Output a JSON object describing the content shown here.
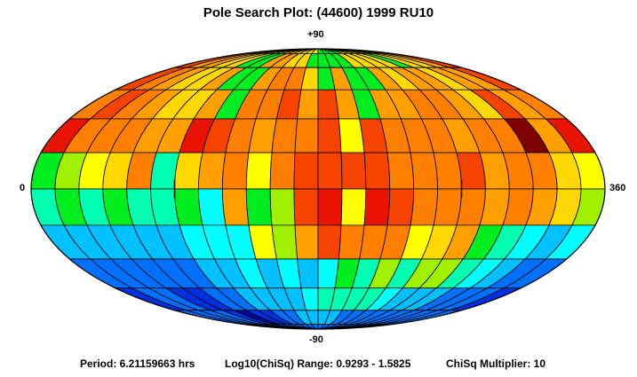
{
  "title": "Pole Search Plot: (44600) 1999 RU10",
  "labels": {
    "top": "+90",
    "bottom": "-90",
    "left": "0",
    "right": "360"
  },
  "footer": {
    "period": "Period: 6.21159663 hrs",
    "range": "Log10(ChiSq) Range: 0.9293 - 1.5825",
    "multiplier": "ChiSq Multiplier: 10"
  },
  "chart_data": {
    "type": "heatmap",
    "projection": "equal-area ellipse",
    "title": "Pole Search Plot: (44600) 1999 RU10",
    "x_label_left": "0",
    "x_label_right": "360",
    "y_label_top": "+90",
    "y_label_bottom": "-90",
    "x_range": [
      0,
      360
    ],
    "y_range": [
      -90,
      90
    ],
    "lon_step": 15,
    "lat_step": 15,
    "lat_rows_north_to_south": [
      90,
      75,
      60,
      45,
      30,
      15,
      0,
      -15,
      -30,
      -45,
      -60,
      -75
    ],
    "grid": true,
    "color_scale": {
      "levels": [
        0,
        1,
        2,
        3,
        4,
        5,
        6,
        7,
        8,
        9,
        10,
        11
      ],
      "colors": [
        "#7e0000",
        "#e81300",
        "#f44400",
        "#ff7f00",
        "#ffa000",
        "#ffd800",
        "#ffff00",
        "#a0f000",
        "#00ee20",
        "#00ffb0",
        "#00ffff",
        "#00c0ff",
        "#0070ff",
        "#0030e0",
        "#0008a0"
      ]
    },
    "values": [
      [
        5,
        5,
        5,
        5,
        5,
        5,
        5,
        5,
        5,
        5,
        5,
        5,
        8,
        8,
        8,
        8,
        5,
        5,
        5,
        5,
        5,
        5,
        5,
        5
      ],
      [
        2,
        4,
        4,
        5,
        5,
        8,
        8,
        4,
        4,
        5,
        5,
        8,
        8,
        8,
        8,
        5,
        5,
        5,
        5,
        8,
        5,
        5,
        4,
        2
      ],
      [
        2,
        3,
        4,
        5,
        5,
        4,
        8,
        8,
        4,
        3,
        3,
        5,
        8,
        4,
        8,
        8,
        4,
        5,
        4,
        4,
        5,
        4,
        4,
        2
      ],
      [
        3,
        2,
        3,
        4,
        5,
        5,
        4,
        8,
        3,
        3,
        2,
        4,
        2,
        4,
        8,
        4,
        4,
        3,
        3,
        4,
        5,
        2,
        4,
        3
      ],
      [
        1,
        3,
        3,
        3,
        4,
        4,
        1,
        2,
        3,
        4,
        3,
        3,
        2,
        6,
        2,
        3,
        3,
        3,
        4,
        3,
        3,
        0,
        4,
        1
      ],
      [
        8,
        7,
        6,
        5,
        3,
        9,
        5,
        4,
        3,
        6,
        3,
        2,
        2,
        2,
        2,
        3,
        3,
        3,
        2,
        4,
        3,
        3,
        5,
        6
      ],
      [
        9,
        8,
        9,
        8,
        9,
        9,
        8,
        10,
        4,
        8,
        7,
        2,
        1,
        6,
        1,
        2,
        3,
        3,
        3,
        4,
        3,
        4,
        5,
        7
      ],
      [
        11,
        11,
        11,
        11,
        11,
        11,
        10,
        10,
        10,
        6,
        7,
        4,
        2,
        3,
        3,
        3,
        6,
        5,
        4,
        8,
        9,
        10,
        11,
        10
      ],
      [
        12,
        12,
        12,
        12,
        12,
        12,
        11,
        11,
        10,
        11,
        10,
        11,
        10,
        8,
        9,
        7,
        9,
        7,
        7,
        9,
        10,
        11,
        12,
        12
      ],
      [
        13,
        12,
        12,
        13,
        13,
        12,
        12,
        11,
        11,
        11,
        11,
        10,
        9,
        9,
        9,
        9,
        10,
        11,
        11,
        11,
        12,
        12,
        12,
        13
      ],
      [
        12,
        12,
        12,
        12,
        13,
        14,
        13,
        13,
        12,
        12,
        11,
        11,
        11,
        11,
        12,
        12,
        12,
        12,
        12,
        12,
        12,
        12,
        12,
        12
      ],
      [
        12,
        12,
        12,
        12,
        12,
        12,
        12,
        12,
        12,
        12,
        12,
        12,
        12,
        12,
        12,
        12,
        12,
        12,
        12,
        12,
        12,
        12,
        12,
        12
      ]
    ]
  }
}
